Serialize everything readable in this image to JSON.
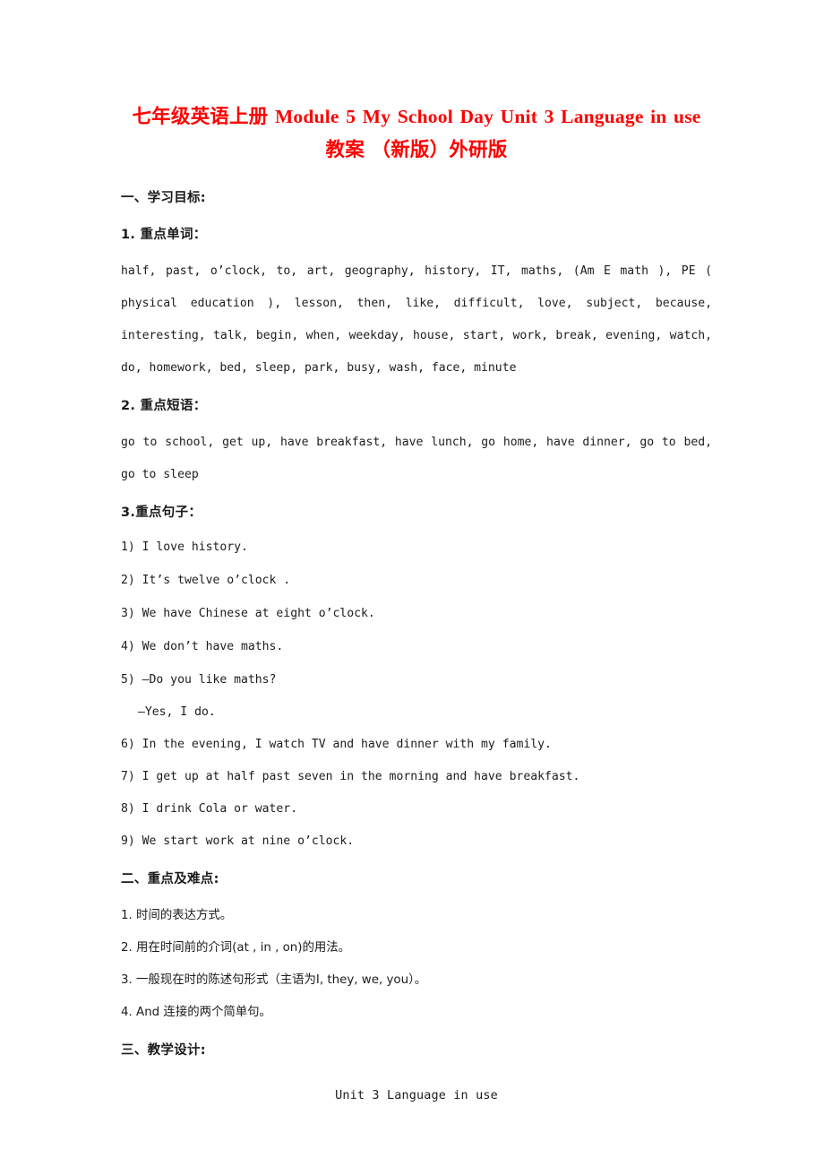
{
  "document": {
    "title_line_1": "七年级英语上册 Module 5 My School Day Unit 3 Language in use",
    "title_line_2": "教案 （新版）外研版",
    "title_color": "#ff0000",
    "page_background": "#ffffff",
    "body_color": "#1c1c1c"
  },
  "section_1": {
    "heading": "一、学习目标:",
    "sub_1": {
      "heading": "1. 重点单词：",
      "lines": [
        "half, past, o’clock, to, art, geography, history, IT, maths, (Am E math ), PE (",
        "physical education ), lesson, then, like, difficult, love, subject, because,",
        "interesting, talk, begin, when, weekday, house, start, work, break, evening, watch,",
        "do, homework, bed, sleep, park, busy, wash, face, minute"
      ]
    },
    "sub_2": {
      "heading": "2. 重点短语：",
      "lines": [
        "go to school, get up, have breakfast, have lunch, go home, have dinner, go to bed,",
        "go to sleep"
      ]
    },
    "sub_3": {
      "heading": "3.重点句子：",
      "sentences": [
        "1) I love history.",
        "2) It’s twelve o’clock .",
        "3) We have Chinese at eight o’clock.",
        "4) We don’t have maths.",
        "5) —Do you like maths?",
        "—Yes, I do.",
        "6) In the evening, I watch TV and have dinner with my family.",
        "7) I get up at half past seven in the morning and have breakfast.",
        "8) I drink Cola or water.",
        "9) We start work at nine o’clock."
      ]
    }
  },
  "section_2": {
    "heading": "二、重点及难点:",
    "items": [
      "1. 时间的表达方式。",
      "2. 用在时间前的介词(at , in , on)的用法。",
      "3. 一般现在时的陈述句形式（主语为I, they, we, you）。",
      "4. And 连接的两个简单句。"
    ]
  },
  "section_3": {
    "heading": "三、教学设计:",
    "subtitle": "Unit 3 Language in use"
  }
}
